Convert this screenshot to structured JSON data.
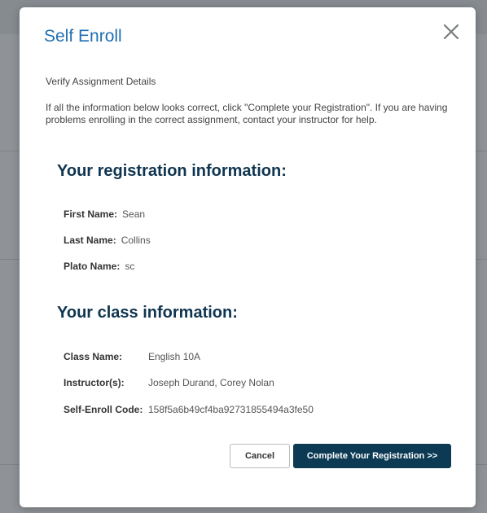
{
  "modal": {
    "title": "Self Enroll",
    "subtitle": "Verify Assignment Details",
    "instructions": "If all the information below looks correct, click \"Complete your Registration\". If you are having problems enrolling in the correct assignment, contact your instructor for help."
  },
  "registration": {
    "heading": "Your registration information:",
    "first_name_label": "First Name:",
    "first_name_value": "Sean",
    "last_name_label": "Last Name:",
    "last_name_value": "Collins",
    "plato_name_label": "Plato Name:",
    "plato_name_value": "sc"
  },
  "class_info": {
    "heading": "Your class information:",
    "class_name_label": "Class Name:",
    "class_name_value": "English 10A",
    "instructors_label": "Instructor(s):",
    "instructors_value": "Joseph Durand, Corey Nolan",
    "code_label": "Self-Enroll Code:",
    "code_value": "158f5a6b49cf4ba92731855494a3fe50"
  },
  "buttons": {
    "cancel": "Cancel",
    "complete": "Complete Your Registration >>"
  },
  "colors": {
    "title": "#1f6fb2",
    "heading": "#0f3550",
    "primary_button": "#0c3a54"
  },
  "icons": {
    "close": "close-icon"
  }
}
